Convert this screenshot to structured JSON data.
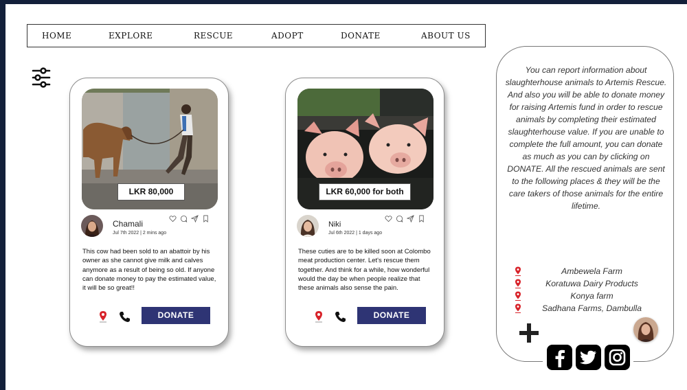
{
  "nav": {
    "items": [
      {
        "label": "HOME"
      },
      {
        "label": "EXPLORE"
      },
      {
        "label": "RESCUE"
      },
      {
        "label": "ADOPT"
      },
      {
        "label": "DONATE"
      },
      {
        "label": "ABOUT US"
      }
    ]
  },
  "posts": [
    {
      "price": "LKR 80,000",
      "user": "Chamali",
      "date": "Jul 7th 2022 | 2 mins  ago",
      "text": "This cow had been sold to an abattoir by his owner as she cannot give milk and calves anymore as a result of being so old. If anyone can donate money to pay the estimated value, it will be so great!!",
      "donate_label": "DONATE"
    },
    {
      "price": "LKR 60,000 for both",
      "user": "Niki",
      "date": "Jul 6th 2022 | 1 days ago",
      "text": "These cuties are to be killed soon at Colombo meat production center. Let's rescue them together. And think for a while, how wonderful would the day be when people realize that these animals also sense the pain.",
      "donate_label": "DONATE"
    }
  ],
  "info": {
    "text": "You can report information about slaughterhouse animals to Artemis Rescue. And also you will be able to donate money for raising Artemis fund in order to rescue animals by completing their estimated slaughterhouse value. If you are unable to complete the full amount, you can donate as much as you can by clicking on DONATE. All the rescued animals are sent to the following places & they will be the care takers of those animals for the entire lifetime.",
    "places": [
      "Ambewela Farm",
      "Koratuwa Dairy Products",
      "Konya farm",
      "Sadhana Farms, Dambulla"
    ]
  },
  "social": [
    "facebook-icon",
    "twitter-icon",
    "instagram-icon"
  ],
  "colors": {
    "page_border": "#13203a",
    "donate_button": "#2e3474",
    "pin": "#d8232a"
  }
}
